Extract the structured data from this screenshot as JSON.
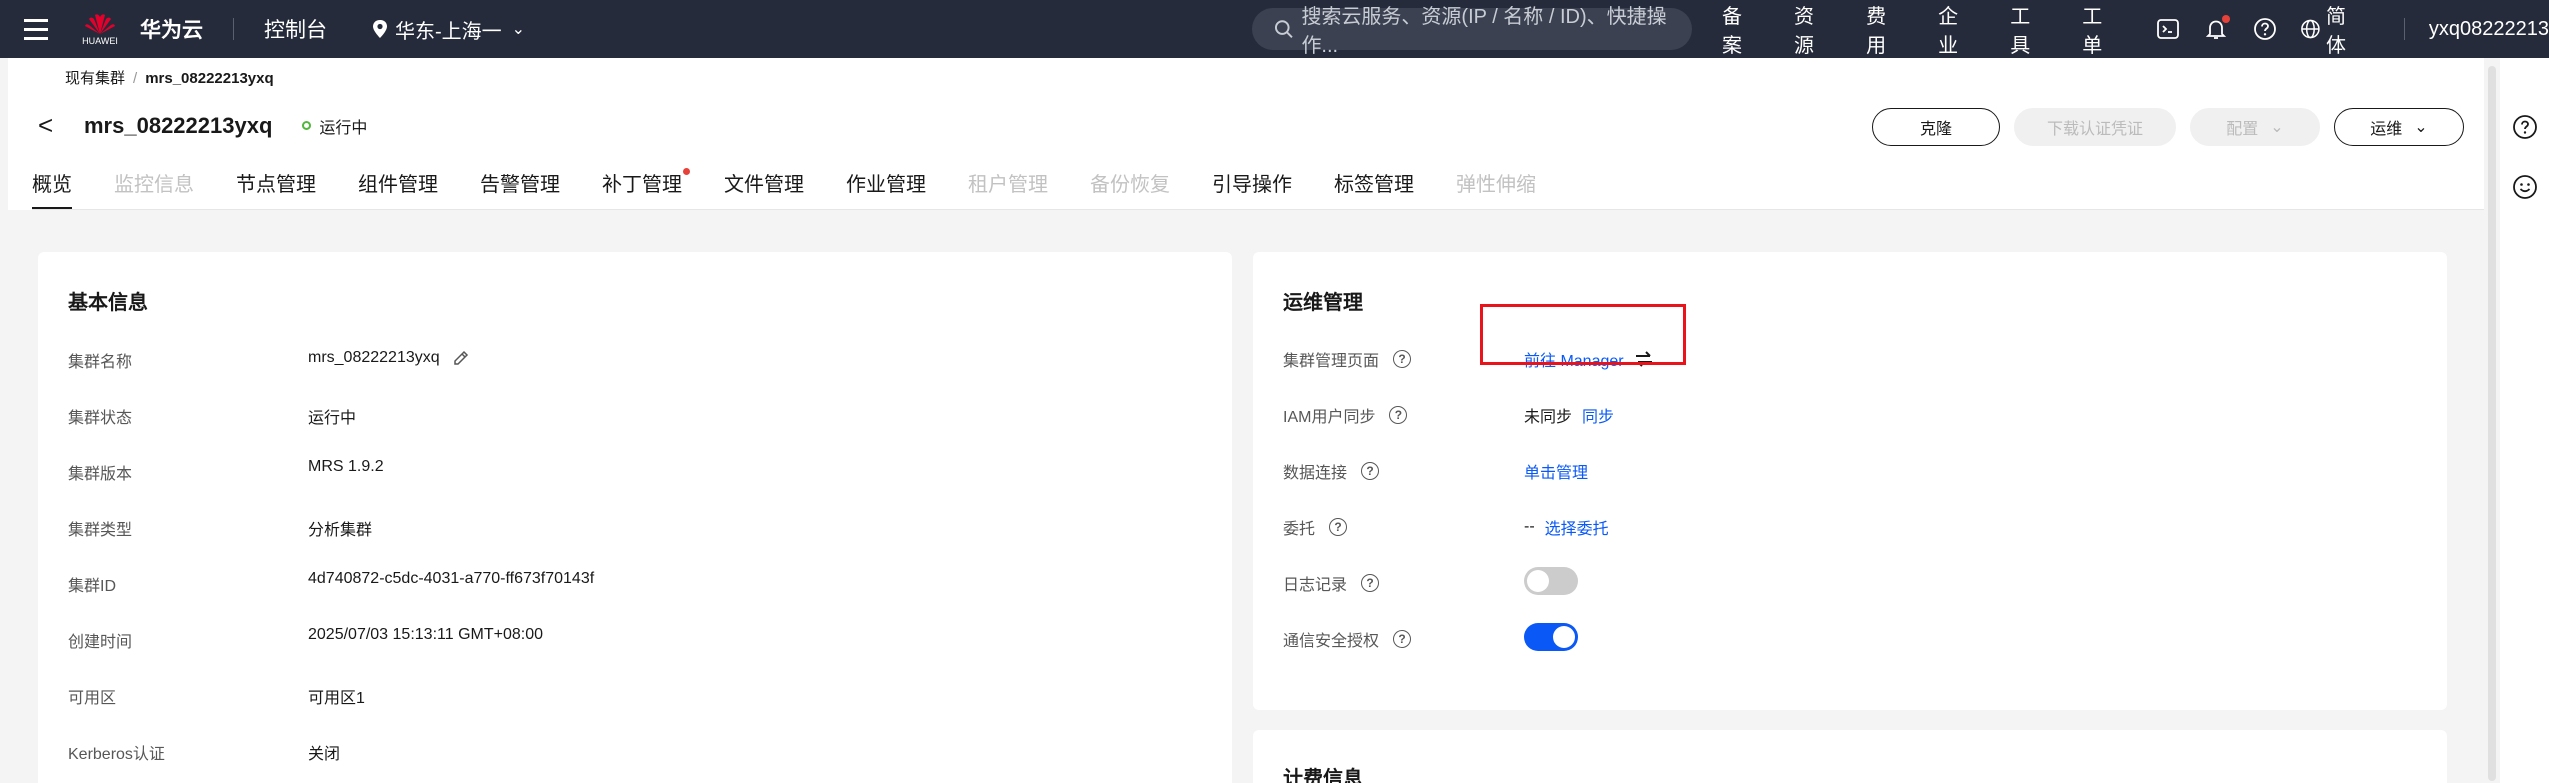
{
  "topbar": {
    "logo_sub": "HUAWEI",
    "brand": "华为云",
    "console": "控制台",
    "region": "华东-上海一",
    "search_placeholder": "搜索云服务、资源(IP / 名称 / ID)、快捷操作...",
    "links": [
      "备案",
      "资源",
      "费用",
      "企业",
      "工具",
      "工单"
    ],
    "language": "简体",
    "username": "yxq08222213"
  },
  "breadcrumb": {
    "parent": "现有集群",
    "separator": "/",
    "current": "mrs_08222213yxq"
  },
  "header": {
    "back_glyph": "<",
    "title": "mrs_08222213yxq",
    "status": "运行中"
  },
  "actions": {
    "clone": "克隆",
    "download_cred": "下载认证凭证",
    "config": "配置",
    "ops": "运维"
  },
  "tabs": [
    {
      "label": "概览",
      "state": "active"
    },
    {
      "label": "监控信息",
      "state": "disabled"
    },
    {
      "label": "节点管理",
      "state": "normal"
    },
    {
      "label": "组件管理",
      "state": "normal"
    },
    {
      "label": "告警管理",
      "state": "normal"
    },
    {
      "label": "补丁管理",
      "state": "normal"
    },
    {
      "label": "文件管理",
      "state": "normal"
    },
    {
      "label": "作业管理",
      "state": "normal"
    },
    {
      "label": "租户管理",
      "state": "disabled"
    },
    {
      "label": "备份恢复",
      "state": "disabled"
    },
    {
      "label": "引导操作",
      "state": "normal"
    },
    {
      "label": "标签管理",
      "state": "normal"
    },
    {
      "label": "弹性伸缩",
      "state": "disabled"
    }
  ],
  "basic_info": {
    "title": "基本信息",
    "rows": [
      {
        "label": "集群名称",
        "value": "mrs_08222213yxq"
      },
      {
        "label": "集群状态",
        "value": "运行中"
      },
      {
        "label": "集群版本",
        "value": "MRS 1.9.2"
      },
      {
        "label": "集群类型",
        "value": "分析集群"
      },
      {
        "label": "集群ID",
        "value": "4d740872-c5dc-4031-a770-ff673f70143f"
      },
      {
        "label": "创建时间",
        "value": "2025/07/03 15:13:11 GMT+08:00"
      },
      {
        "label": "可用区",
        "value": "可用区1"
      },
      {
        "label": "Kerberos认证",
        "value": "关闭"
      }
    ]
  },
  "ops_mgmt": {
    "title": "运维管理",
    "manager_label": "集群管理页面",
    "manager_link": "前往 Manager",
    "iam_label": "IAM用户同步",
    "iam_status": "未同步",
    "iam_link": "同步",
    "data_conn_label": "数据连接",
    "data_conn_link": "单击管理",
    "delegate_label": "委托",
    "delegate_value": "--",
    "delegate_link": "选择委托",
    "log_label": "日志记录",
    "log_enabled": false,
    "comm_label": "通信安全授权",
    "comm_enabled": true
  },
  "billing": {
    "title": "计费信息"
  },
  "colors": {
    "topbar_bg": "#252b3a",
    "link": "#0a59f7",
    "status_green": "#50b83c",
    "highlight_red": "#e8131b"
  }
}
